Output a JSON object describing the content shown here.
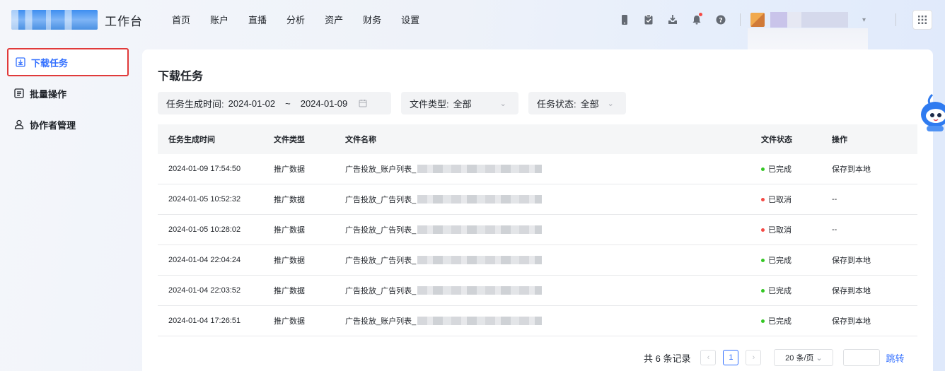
{
  "header": {
    "brand": "工作台",
    "nav": [
      "首页",
      "账户",
      "直播",
      "分析",
      "资产",
      "财务",
      "设置"
    ]
  },
  "sidebar": {
    "items": [
      {
        "label": "下载任务"
      },
      {
        "label": "批量操作"
      },
      {
        "label": "协作者管理"
      }
    ]
  },
  "main": {
    "title": "下载任务",
    "filters": {
      "time_label": "任务生成时间:",
      "time_start": "2024-01-02",
      "time_sep": "~",
      "time_end": "2024-01-09",
      "type_label": "文件类型:",
      "type_value": "全部",
      "status_label": "任务状态:",
      "status_value": "全部"
    },
    "table": {
      "headers": [
        "任务生成时间",
        "文件类型",
        "文件名称",
        "文件状态",
        "操作"
      ],
      "rows": [
        {
          "time": "2024-01-09 17:54:50",
          "type": "推广数据",
          "name": "广告投放_账户列表_",
          "status": "已完成",
          "action": "保存到本地"
        },
        {
          "time": "2024-01-05 10:52:32",
          "type": "推广数据",
          "name": "广告投放_广告列表_",
          "status": "已取消",
          "action": "--"
        },
        {
          "time": "2024-01-05 10:28:02",
          "type": "推广数据",
          "name": "广告投放_广告列表_",
          "status": "已取消",
          "action": "--"
        },
        {
          "time": "2024-01-04 22:04:24",
          "type": "推广数据",
          "name": "广告投放_广告列表_",
          "status": "已完成",
          "action": "保存到本地"
        },
        {
          "time": "2024-01-04 22:03:52",
          "type": "推广数据",
          "name": "广告投放_广告列表_",
          "status": "已完成",
          "action": "保存到本地"
        },
        {
          "time": "2024-01-04 17:26:51",
          "type": "推广数据",
          "name": "广告投放_账户列表_",
          "status": "已完成",
          "action": "保存到本地"
        }
      ]
    },
    "pagination": {
      "total": "共 6 条记录",
      "current_page": "1",
      "page_size": "20 条/页",
      "jump_label": "跳转"
    }
  },
  "colors": {
    "accent": "#3370ff",
    "done": "#34c724",
    "cancelled": "#f54a45",
    "highlight_border": "#e03a3a"
  }
}
